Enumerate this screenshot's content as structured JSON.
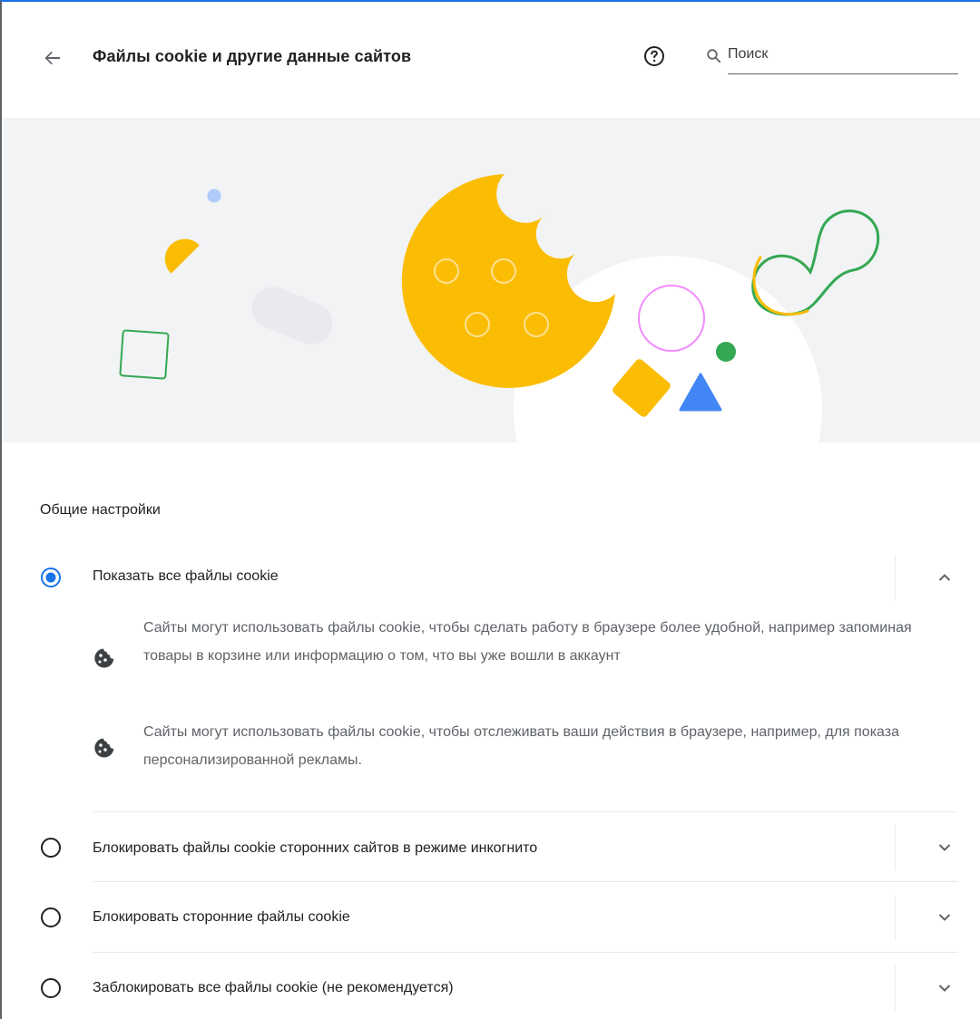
{
  "header": {
    "title": "Файлы cookie и другие данные сайтов",
    "search_placeholder": "Поиск"
  },
  "colors": {
    "accent": "#1a73e8",
    "cookie_yellow": "#fbbc04",
    "green": "#34a853",
    "blue": "#4285f4",
    "pink": "#f28bff",
    "hero_bg": "#f1f3f4"
  },
  "section": {
    "title": "Общие настройки"
  },
  "options": [
    {
      "label": "Показать все файлы cookie",
      "selected": true,
      "expanded": true,
      "details": [
        "Сайты могут использовать файлы cookie, чтобы сделать работу в браузере более удобной, например запоминая товары в корзине или информацию о том, что вы уже вошли в аккаунт",
        "Сайты могут использовать файлы cookie, чтобы отслеживать ваши действия в браузере, например, для показа персонализированной рекламы."
      ]
    },
    {
      "label": "Блокировать файлы cookie сторонних сайтов в режиме инкогнито",
      "selected": false,
      "expanded": false
    },
    {
      "label": "Блокировать сторонние файлы cookie",
      "selected": false,
      "expanded": false
    },
    {
      "label": "Заблокировать все файлы cookie (не рекомендуется)",
      "selected": false,
      "expanded": false
    }
  ],
  "icons": {
    "back": "arrow-back-icon",
    "help": "help-circle-icon",
    "search": "search-icon",
    "cookie": "cookie-icon",
    "expand": "chevron-down-icon",
    "collapse": "chevron-up-icon"
  }
}
